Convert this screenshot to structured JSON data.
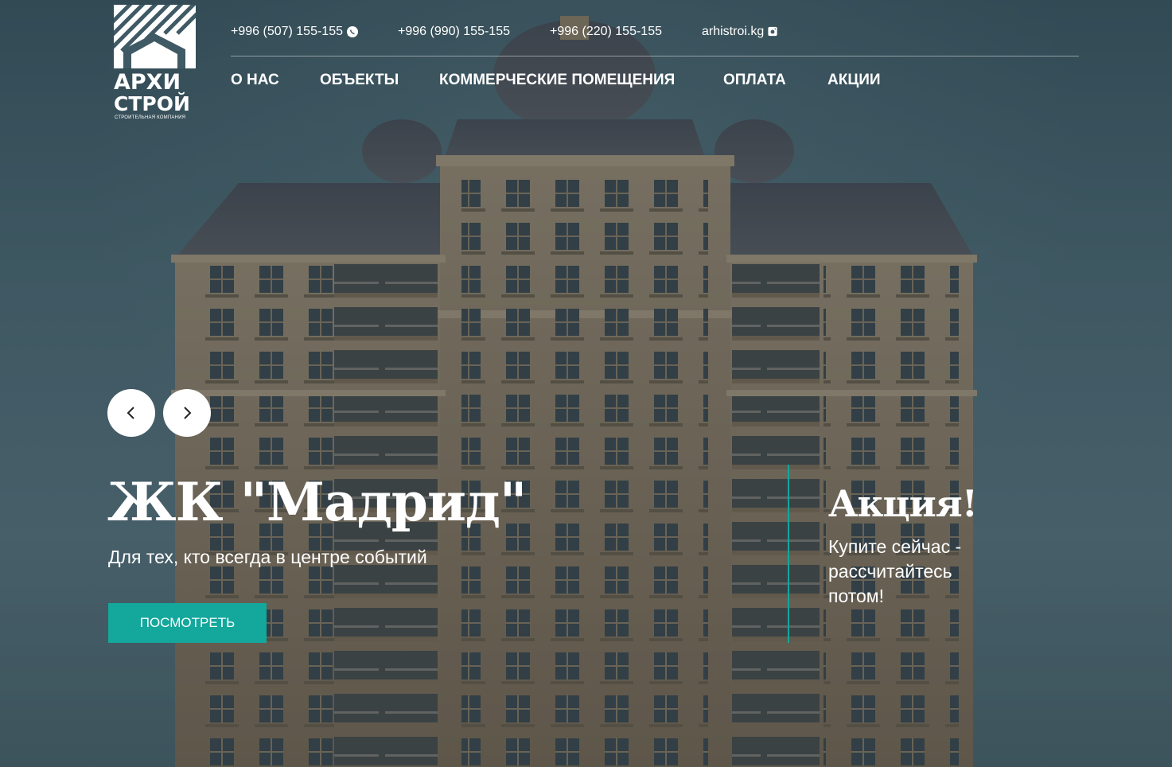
{
  "logo": {
    "line1": "АРХИ",
    "line2": "СТРОЙ",
    "tagline": "СТРОИТЕЛЬНАЯ КОМПАНИЯ"
  },
  "contacts": [
    {
      "text": "+996 (507) 155-155",
      "icon": "whatsapp-icon"
    },
    {
      "text": "+996 (990) 155-155"
    },
    {
      "text": "+996 (220) 155-155"
    },
    {
      "text": "arhistroi.kg",
      "icon": "instagram-icon"
    }
  ],
  "nav": [
    {
      "label": "О НАС"
    },
    {
      "label": "ОБЪЕКТЫ"
    },
    {
      "label": "КОММЕРЧЕСКИЕ ПОМЕЩЕНИЯ"
    },
    {
      "label": "ОПЛАТА"
    },
    {
      "label": "АКЦИИ"
    }
  ],
  "slider": {
    "prev_icon": "chevron-left-icon",
    "next_icon": "chevron-right-icon"
  },
  "hero": {
    "title": "ЖК \"Мадрид\"",
    "subtitle": "Для тех, кто всегда в центре событий",
    "cta_label": "ПОСМОТРЕТЬ"
  },
  "promo": {
    "title": "Акция!",
    "text": "Купите сейчас - рассчитайтесь потом!"
  },
  "colors": {
    "accent": "#14a79c",
    "text": "#ffffff"
  }
}
